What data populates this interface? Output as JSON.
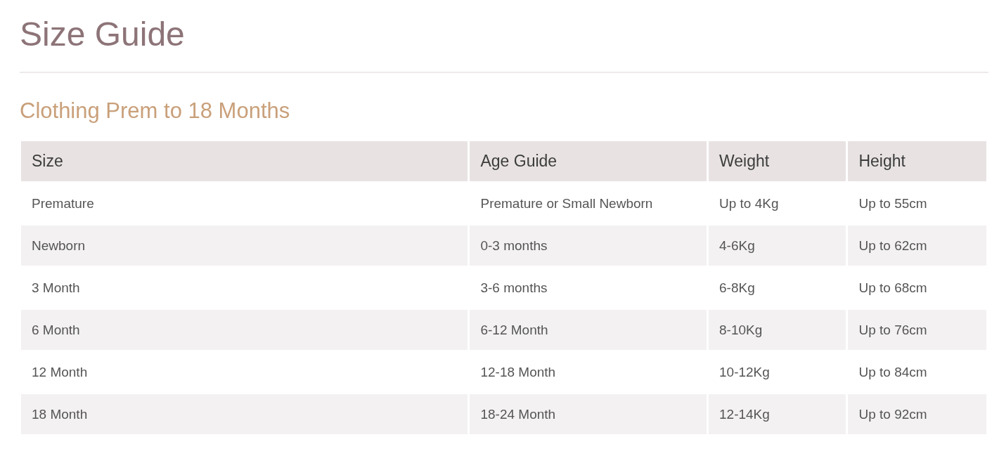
{
  "title": "Size Guide",
  "section_title": "Clothing Prem to 18 Months",
  "table": {
    "columns": [
      "Size",
      "Age Guide",
      "Weight",
      "Height"
    ],
    "rows": [
      [
        "Premature",
        "Premature or Small Newborn",
        "Up to 4Kg",
        "Up to 55cm"
      ],
      [
        "Newborn",
        "0-3 months",
        "4-6Kg",
        "Up to 62cm"
      ],
      [
        "3 Month",
        "3-6 months",
        "6-8Kg",
        "Up to 68cm"
      ],
      [
        "6 Month",
        "6-12 Month",
        "8-10Kg",
        "Up to 76cm"
      ],
      [
        "12 Month",
        "12-18 Month",
        "10-12Kg",
        "Up to 84cm"
      ],
      [
        "18 Month",
        "18-24 Month",
        "12-14Kg",
        "Up to 92cm"
      ]
    ]
  }
}
